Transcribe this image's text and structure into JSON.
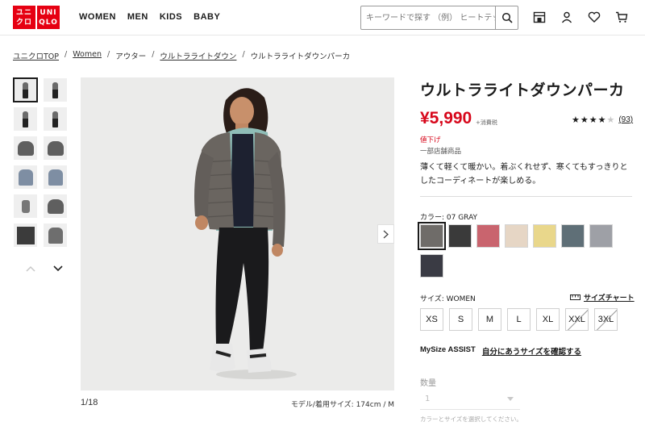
{
  "header": {
    "logo_top": "ユニ UNI",
    "logo_bottom": "クロ QLO",
    "logo_tiles": [
      {
        "line1": "ユニ",
        "line2": "クロ"
      },
      {
        "line1": "UNI",
        "line2": "QLO"
      }
    ],
    "nav": [
      "WOMEN",
      "MEN",
      "KIDS",
      "BABY"
    ],
    "search_placeholder": "キーワードで探す （例） ヒートテック",
    "icons": [
      "store-icon",
      "account-icon",
      "heart-icon",
      "cart-icon"
    ]
  },
  "breadcrumb": [
    {
      "label": "ユニクロTOP",
      "link": true
    },
    {
      "label": "Women",
      "link": true
    },
    {
      "label": "アウター",
      "link": false
    },
    {
      "label": "ウルトラライトダウン",
      "link": true
    },
    {
      "label": "ウルトラライトダウンパーカ",
      "link": false
    }
  ],
  "gallery": {
    "counter": "1/18",
    "model_size": "モデル/着用サイズ: 174cm / M",
    "selected_thumb": 0,
    "thumb_count": 12
  },
  "product": {
    "title": "ウルトラライトダウンパーカ",
    "price": "¥5,990",
    "tax_note": "+消費税",
    "rating_stars": 4,
    "rating_max": 5,
    "review_count": "(93)",
    "sale_label": "値下げ",
    "store_label": "一部店舗商品",
    "description": "薄くて軽くて暖かい。着ぶくれせず、寒くてもすっきりとしたコーディネートが楽しめる。"
  },
  "color": {
    "label": "カラー: 07 GRAY",
    "selected": 0,
    "swatches": [
      "#6f6c69",
      "#3a3a3a",
      "#c9646e",
      "#e6d6c5",
      "#e9d78b",
      "#5f6f77",
      "#9ea0a6",
      "#3a3b44"
    ]
  },
  "size": {
    "label": "サイズ: WOMEN",
    "chart_label": "サイズチャート",
    "options": [
      {
        "label": "XS",
        "available": true
      },
      {
        "label": "S",
        "available": true
      },
      {
        "label": "M",
        "available": true
      },
      {
        "label": "L",
        "available": true
      },
      {
        "label": "XL",
        "available": true
      },
      {
        "label": "XXL",
        "available": false
      },
      {
        "label": "3XL",
        "available": false
      }
    ]
  },
  "mysize": {
    "label": "MySize ASSIST",
    "link": "自分にあうサイズを確認する"
  },
  "quantity": {
    "label": "数量",
    "value": "1",
    "note": "カラーとサイズを選択してください。"
  }
}
